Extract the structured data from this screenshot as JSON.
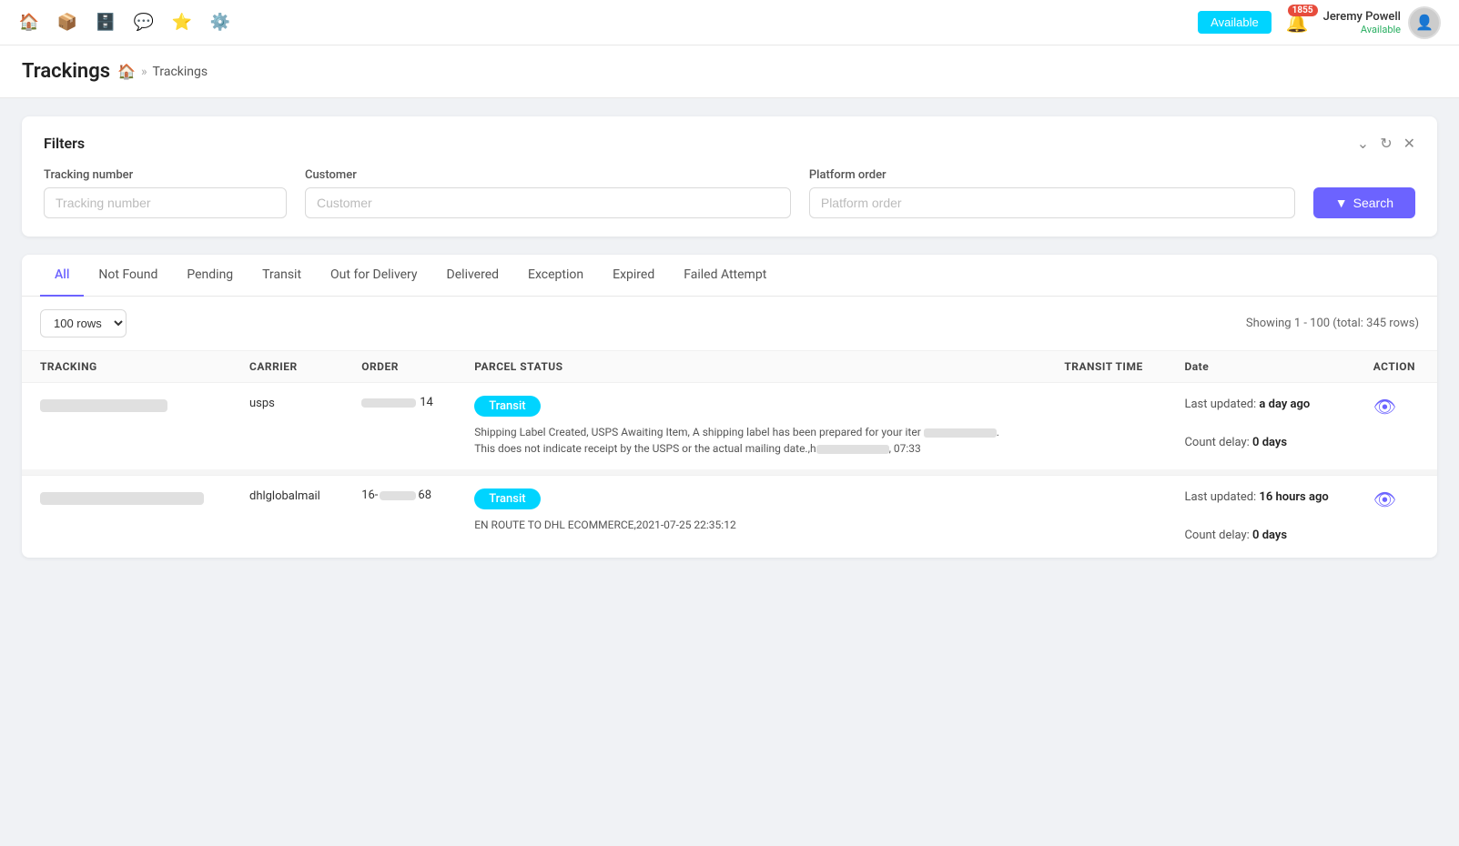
{
  "nav": {
    "icons": [
      "home",
      "box",
      "archive",
      "comment",
      "star",
      "gear"
    ],
    "status_button": "Available",
    "notification_count": "1855",
    "user_name": "Jeremy Powell",
    "user_status": "Available"
  },
  "page": {
    "title": "Trackings",
    "breadcrumb_home": "🏠",
    "breadcrumb_sep": "»",
    "breadcrumb_current": "Trackings"
  },
  "filters": {
    "title": "Filters",
    "tracking_label": "Tracking number",
    "tracking_placeholder": "Tracking number",
    "customer_label": "Customer",
    "customer_placeholder": "Customer",
    "platform_label": "Platform order",
    "platform_placeholder": "Platform order",
    "search_label": "Search"
  },
  "tabs": [
    "All",
    "Not Found",
    "Pending",
    "Transit",
    "Out for Delivery",
    "Delivered",
    "Exception",
    "Expired",
    "Failed Attempt"
  ],
  "active_tab": "All",
  "table": {
    "rows_option": "100 rows",
    "showing_info": "Showing 1 - 100 (total: 345 rows)",
    "columns": [
      "TRACKING",
      "CARRIER",
      "ORDER",
      "PARCEL STATUS",
      "TRANSIT TIME",
      "Date",
      "ACTION"
    ],
    "rows": [
      {
        "carrier": "usps",
        "order_num": "14",
        "status": "Transit",
        "description": "Shipping Label Created, USPS Awaiting Item, A shipping label has been prepared for your iter [redacted]. This does not indicate receipt by the USPS or the actual mailing date.,h[redacted], 07:33",
        "last_updated_label": "Last updated:",
        "last_updated_val": "a day ago",
        "count_delay_label": "Count delay:",
        "count_delay_val": "0 days"
      },
      {
        "carrier": "dhlglobalmail",
        "order_num": "16-[redacted]68",
        "status": "Transit",
        "description": "EN ROUTE TO DHL ECOMMERCE,2021-07-25 22:35:12",
        "last_updated_label": "Last updated:",
        "last_updated_val": "16 hours ago",
        "count_delay_label": "Count delay:",
        "count_delay_val": "0 days"
      }
    ]
  }
}
